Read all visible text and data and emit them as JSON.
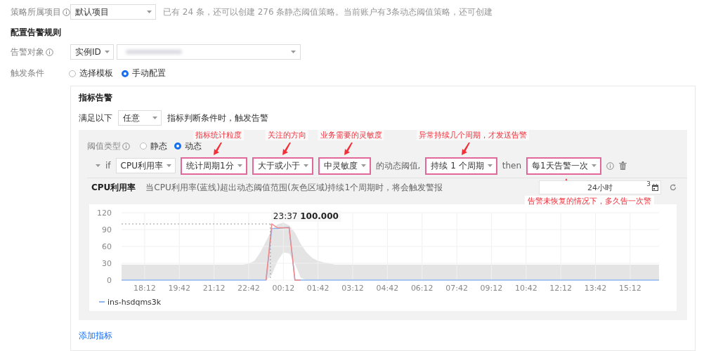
{
  "project": {
    "label": "策略所属项目",
    "value": "默认项目",
    "note": "已有 24 条，还可以创建 276 条静态阈值策略。当前账户有3条动态阈值策略，还可创建"
  },
  "section_title": "配置告警规则",
  "target": {
    "label": "告警对象",
    "type_value": "实例ID"
  },
  "trigger": {
    "label": "触发条件",
    "options": [
      {
        "label": "选择模板",
        "selected": false
      },
      {
        "label": "手动配置",
        "selected": true
      }
    ]
  },
  "metric_alarm": {
    "title": "指标告警",
    "condition_prefix": "满足以下",
    "condition_value": "任意",
    "condition_suffix": "指标判断条件时，触发告警",
    "threshold_type": {
      "label": "阈值类型",
      "options": [
        {
          "label": "静态",
          "selected": false
        },
        {
          "label": "动态",
          "selected": true
        }
      ]
    },
    "rule": {
      "expanded": false,
      "items": [
        {
          "kind": "text",
          "text": "if"
        },
        {
          "kind": "select",
          "value": "CPU利用率",
          "highlighted": false
        },
        {
          "kind": "select",
          "value": "统计周期1分",
          "highlighted": true,
          "callout": "指标统计粒度"
        },
        {
          "kind": "select",
          "value": "大于或小于",
          "highlighted": true,
          "callout": "关注的方向"
        },
        {
          "kind": "select",
          "value": "中灵敏度",
          "highlighted": true,
          "callout": "业务需要的灵敏度"
        },
        {
          "kind": "text",
          "text": "的动态阈值,"
        },
        {
          "kind": "select",
          "value": "持续 1 个周期",
          "highlighted": true,
          "callout": "异常持续几个周期，才发送告警"
        },
        {
          "kind": "text",
          "text": "then"
        },
        {
          "kind": "select",
          "value": "每1天告警一次",
          "highlighted": true,
          "callout_below": "告警未恢复的情况下，多久告一次警"
        }
      ]
    },
    "chart_panel": {
      "title": "CPU利用率",
      "description": "当CPU利用率(蓝线)超出动态阈值范围(灰色区域)持续1个周期时，将会触发警报",
      "time_range": "24小时",
      "time_badge": "3",
      "chart_data": {
        "type": "line",
        "categories": [
          null,
          null,
          null,
          null,
          "18:12",
          null,
          null,
          null,
          null,
          null,
          "19:42",
          null,
          null,
          null,
          null,
          null,
          "21:12",
          null,
          null,
          null,
          null,
          null,
          "22:42",
          null,
          null,
          null,
          null,
          null,
          "00:12",
          null,
          null,
          null,
          null,
          null,
          "01:42",
          null,
          null,
          null,
          null,
          null,
          "03:12",
          null,
          null,
          null,
          null,
          null,
          "04:42",
          null,
          null,
          null,
          null,
          null,
          "06:12",
          null,
          null,
          null,
          null,
          null,
          "07:42",
          null,
          null,
          null,
          null,
          null,
          "09:12",
          null,
          null,
          null,
          null,
          null,
          "10:42",
          null,
          null,
          null,
          null,
          null,
          "12:12",
          null,
          null,
          null,
          null,
          null,
          "13:42",
          null,
          null,
          null,
          null,
          null,
          "15:12",
          null,
          null,
          null,
          null,
          null
        ],
        "series": [
          {
            "name": "ins-hsdqms3k",
            "color": "#8fb6f2",
            "values": [
              0,
              0,
              0,
              0,
              0,
              0,
              0,
              0,
              0,
              0,
              0,
              0,
              0,
              0,
              0,
              0,
              0,
              0,
              0,
              0,
              0,
              0,
              0,
              0,
              0,
              0,
              92,
              92,
              93,
              94,
              0,
              0,
              0,
              0,
              0,
              0,
              0,
              0,
              0,
              0,
              0,
              0,
              0,
              0,
              0,
              0,
              0,
              0,
              0,
              0,
              0,
              0,
              0,
              0,
              0,
              0,
              0,
              0,
              0,
              0,
              0,
              0,
              0,
              0,
              0,
              0,
              0,
              0,
              0,
              0,
              0,
              0,
              0,
              0,
              0,
              0,
              0,
              0,
              0,
              0,
              0,
              0,
              0,
              0,
              0,
              0,
              0,
              0,
              0,
              0,
              0,
              0,
              0,
              0
            ]
          },
          {
            "color": "#f08a8a",
            "values": [
              null,
              null,
              null,
              null,
              null,
              null,
              null,
              null,
              null,
              null,
              null,
              null,
              null,
              null,
              null,
              null,
              null,
              null,
              null,
              null,
              null,
              null,
              null,
              null,
              null,
              0,
              100,
              93,
              93,
              93,
              0,
              0,
              null,
              null,
              null,
              null,
              null,
              null,
              null,
              null,
              null,
              null,
              null,
              null,
              null,
              null,
              null,
              null,
              null,
              null,
              null,
              null,
              null,
              null,
              null,
              null,
              null,
              null,
              null,
              null,
              null,
              null,
              null,
              null,
              null,
              null,
              null,
              null,
              null,
              null,
              null,
              null,
              null,
              null,
              null,
              null,
              null,
              null,
              null,
              null,
              null,
              null,
              null,
              null,
              null,
              null,
              null,
              null,
              null,
              null,
              null,
              null,
              null,
              null
            ]
          }
        ],
        "ylim": [
          0,
          120
        ],
        "grid": true,
        "yticks": [
          0,
          30,
          60,
          90,
          120
        ],
        "annotations": [
          "23:37 **100.000**"
        ]
      }
    }
  },
  "add_metric": "添加指标"
}
